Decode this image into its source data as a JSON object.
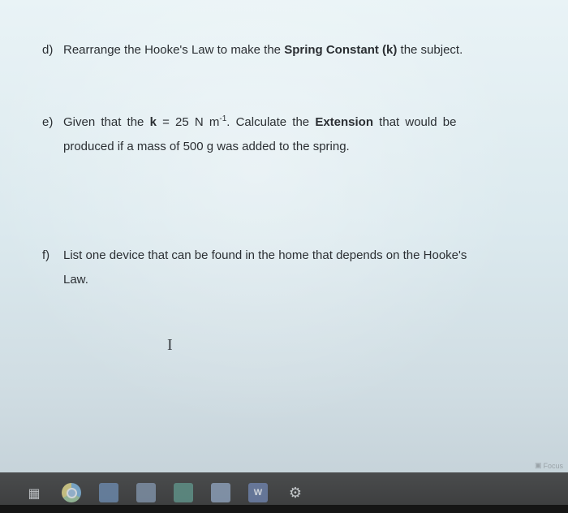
{
  "questions": {
    "d": {
      "label": "d)",
      "text_before": "Rearrange the Hooke's Law to make the ",
      "bold": "Spring Constant (k)",
      "text_after": " the subject."
    },
    "e": {
      "label": "e)",
      "given_start": "Given that the ",
      "k_symbol": "k",
      "equals": " = 25 N m",
      "exponent": "-1",
      "after_unit": ".  Calculate the ",
      "bold": "Extension",
      "end": " that would be",
      "line2": "produced if a mass of 500 g was added to the spring."
    },
    "f": {
      "label": "f)",
      "line1": "List one device that can be found in the home that depends on the Hooke's",
      "line2": "Law."
    }
  },
  "cursor": {
    "glyph": "I"
  },
  "focus": {
    "icon": "focus-icon",
    "label": "Focus"
  },
  "taskbar": {
    "icons": [
      "task-view-icon",
      "chrome-icon",
      "file-explorer-icon",
      "store-icon",
      "mail-icon",
      "photos-icon",
      "word-icon",
      "settings-icon"
    ],
    "word_letter": "W"
  }
}
